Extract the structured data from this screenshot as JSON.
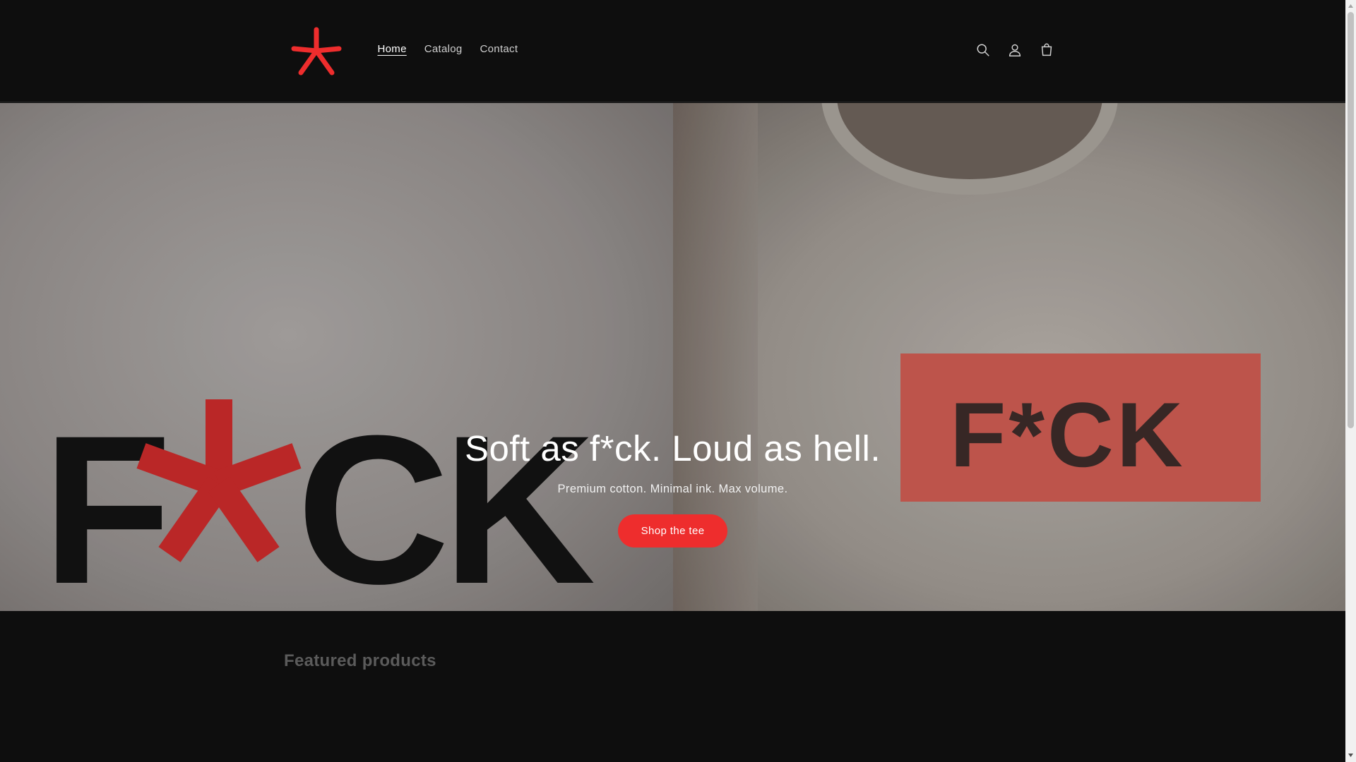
{
  "header": {
    "logo_icon": "asterisk-logo-icon",
    "brand_color": "#ee2d2d",
    "nav": [
      {
        "label": "Home",
        "active": true
      },
      {
        "label": "Catalog",
        "active": false
      },
      {
        "label": "Contact",
        "active": false
      }
    ],
    "icons": [
      "search-icon",
      "account-icon",
      "cart-icon"
    ]
  },
  "hero": {
    "left_print": "F*CK",
    "right_print": "F*CK",
    "title": "Soft as f*ck. Loud as hell.",
    "subtitle": "Premium cotton. Minimal ink. Max volume.",
    "cta_label": "Shop the tee",
    "cta_color": "#ee2d2d"
  },
  "featured": {
    "title": "Featured products"
  }
}
